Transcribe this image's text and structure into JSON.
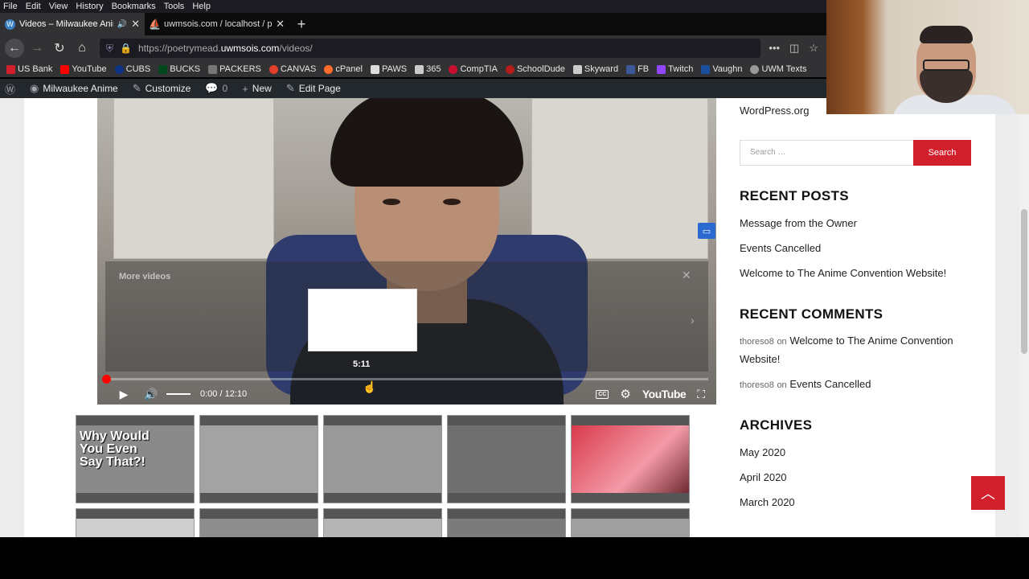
{
  "menu": [
    "File",
    "Edit",
    "View",
    "History",
    "Bookmarks",
    "Tools",
    "Help"
  ],
  "tabs": [
    {
      "title": "Videos – Milwaukee Anime",
      "active": true,
      "favicon": "wordpress-icon"
    },
    {
      "title": "uwmsois.com / localhost / poe",
      "active": false,
      "favicon": "phpmyadmin-icon"
    }
  ],
  "nav": {
    "url_prefix": "https://poetrymead.",
    "url_host": "uwmsois.com",
    "url_path": "/videos/"
  },
  "bookmarks": [
    "US Bank",
    "YouTube",
    "CUBS",
    "BUCKS",
    "PACKERS",
    "CANVAS",
    "cPanel",
    "PAWS",
    "365",
    "CompTIA",
    "SchoolDude",
    "Skyward",
    "FB",
    "Twitch",
    "Vaughn",
    "UWM Texts"
  ],
  "wpbar": {
    "site": "Milwaukee Anime",
    "customize": "Customize",
    "comments": "0",
    "new": "New",
    "edit": "Edit Page"
  },
  "video": {
    "more_videos": "More videos",
    "hover_time": "5:11",
    "time": "0:00 / 12:10",
    "brand": "YouTube",
    "cc": "CC",
    "progress_fraction": 0.0
  },
  "thumbs": [
    {
      "caption": "Why Would You Even Say That?!"
    },
    {
      "caption": ""
    },
    {
      "caption": ""
    },
    {
      "caption": ""
    },
    {
      "caption": ""
    }
  ],
  "sidebar": {
    "wporg": "WordPress.org",
    "search_placeholder": "Search …",
    "search_button": "Search",
    "recent_posts_title": "RECENT POSTS",
    "recent_posts": [
      "Message from the Owner",
      "Events Cancelled",
      "Welcome to The Anime Convention Website!"
    ],
    "recent_comments_title": "RECENT COMMENTS",
    "recent_comments": [
      {
        "author": "thoreso8",
        "on": "on",
        "post": "Welcome to The Anime Convention Website!"
      },
      {
        "author": "thoreso8",
        "on": "on",
        "post": "Events Cancelled"
      }
    ],
    "archives_title": "ARCHIVES",
    "archives": [
      "May 2020",
      "April 2020",
      "March 2020"
    ]
  },
  "colors": {
    "accent": "#d11f2b",
    "admin_bar": "#23282d"
  }
}
